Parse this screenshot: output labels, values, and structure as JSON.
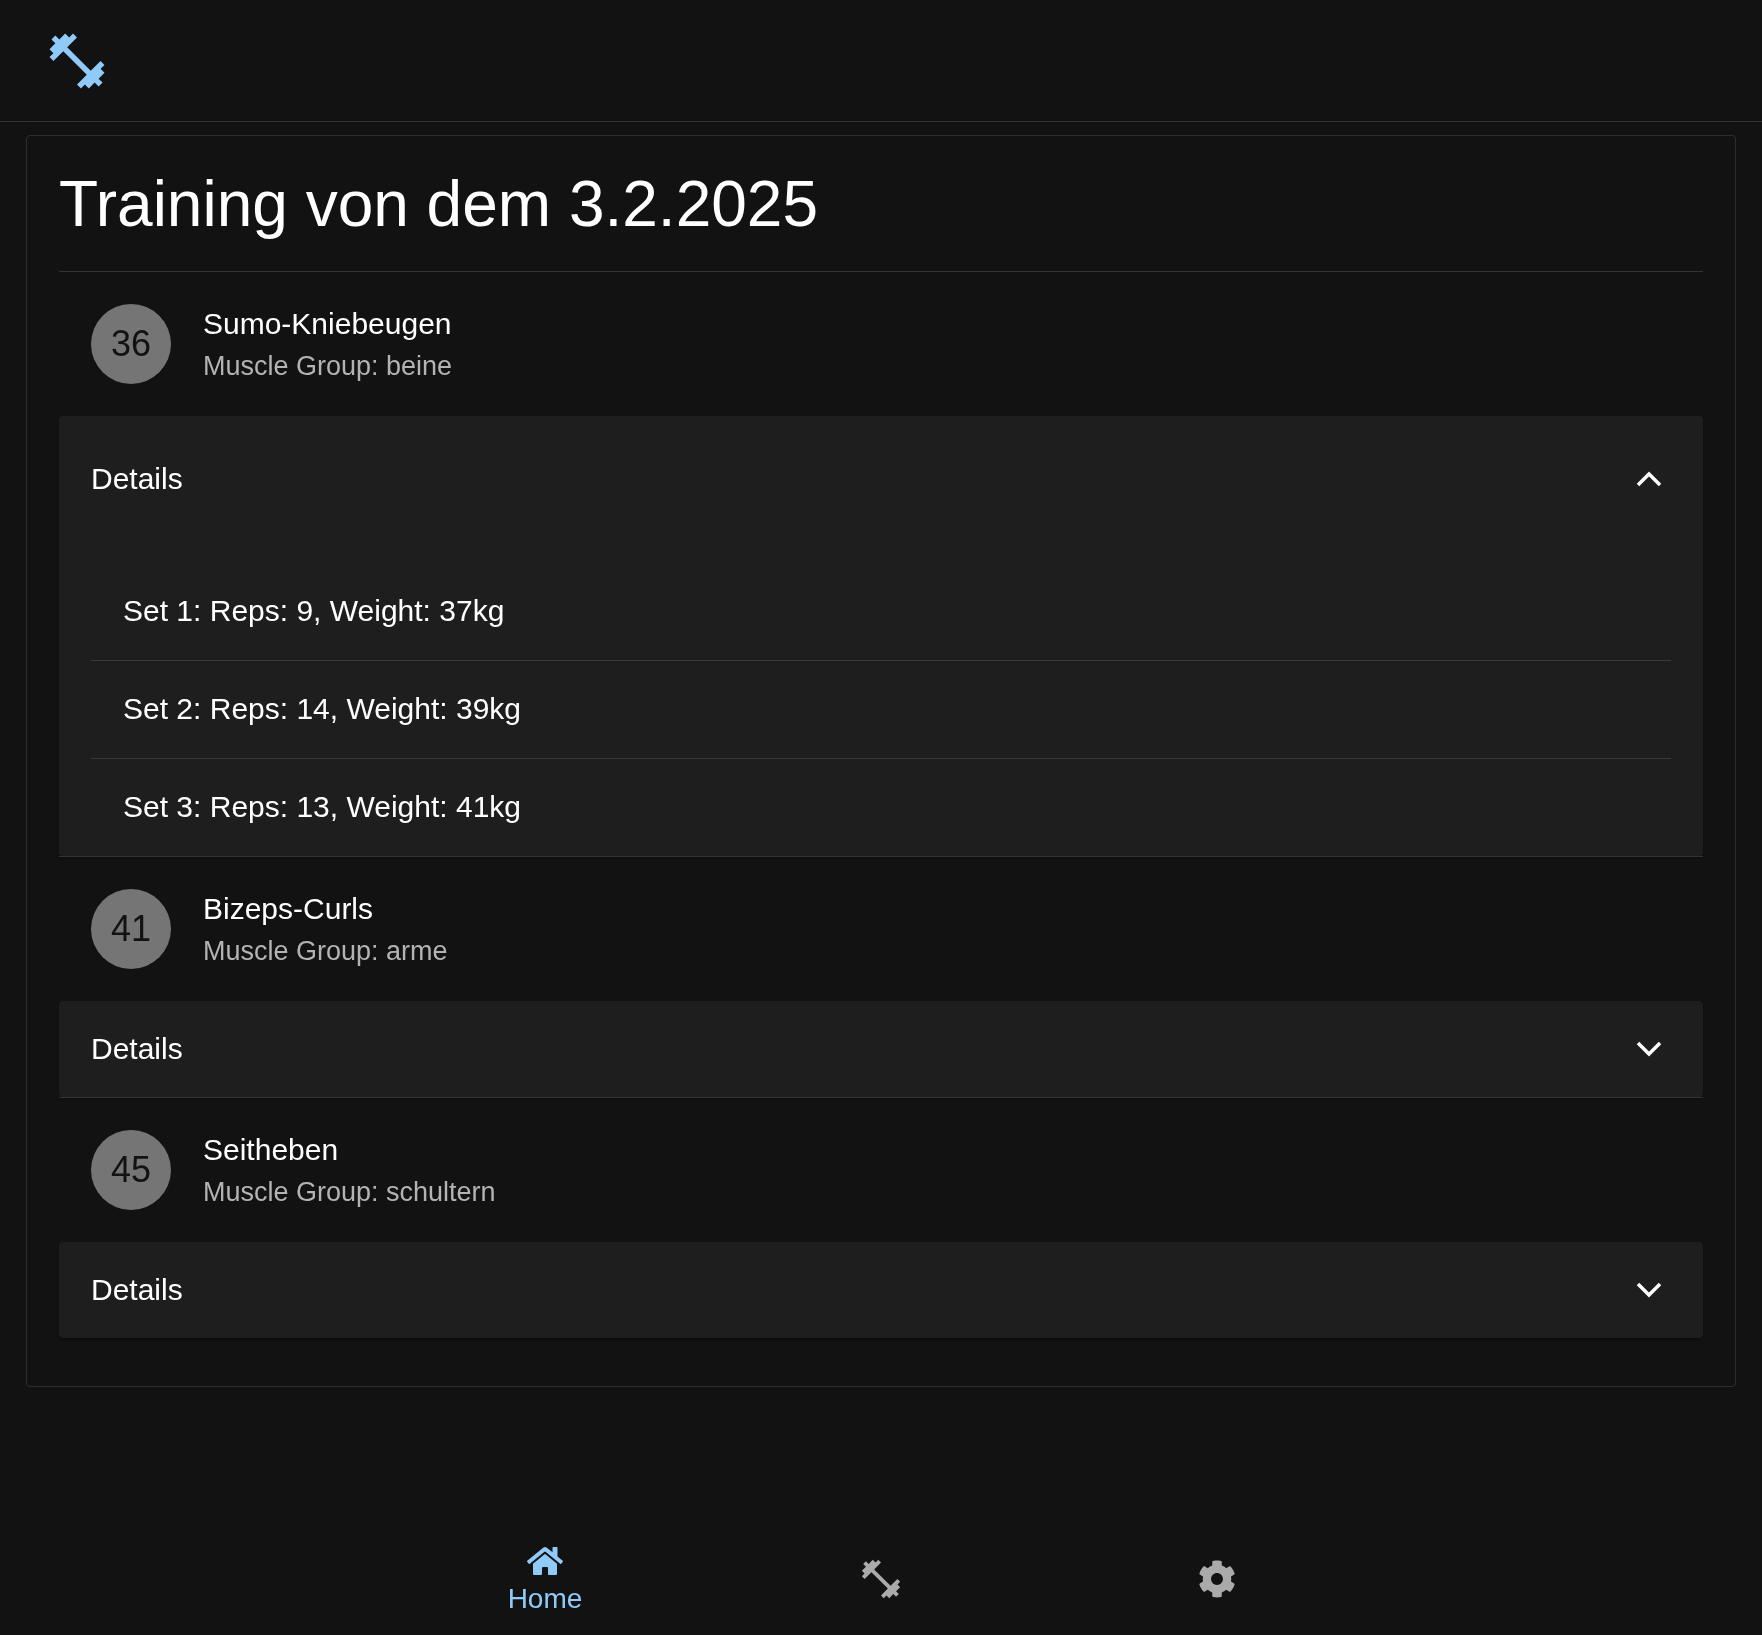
{
  "title": "Training von dem 3.2.2025",
  "exercises": [
    {
      "number": "36",
      "name": "Sumo-Kniebeugen",
      "muscle_group": "Muscle Group: beine",
      "details_label": "Details",
      "expanded": true,
      "sets": [
        "Set 1: Reps: 9, Weight: 37kg",
        "Set 2: Reps: 14, Weight: 39kg",
        "Set 3: Reps: 13, Weight: 41kg"
      ]
    },
    {
      "number": "41",
      "name": "Bizeps-Curls",
      "muscle_group": "Muscle Group: arme",
      "details_label": "Details",
      "expanded": false
    },
    {
      "number": "45",
      "name": "Seitheben",
      "muscle_group": "Muscle Group: schultern",
      "details_label": "Details",
      "expanded": false
    }
  ],
  "bottom_nav": [
    {
      "kind": "home",
      "label": "Home",
      "selected": true
    },
    {
      "kind": "workout",
      "selected": false
    },
    {
      "kind": "settings",
      "selected": false
    }
  ]
}
